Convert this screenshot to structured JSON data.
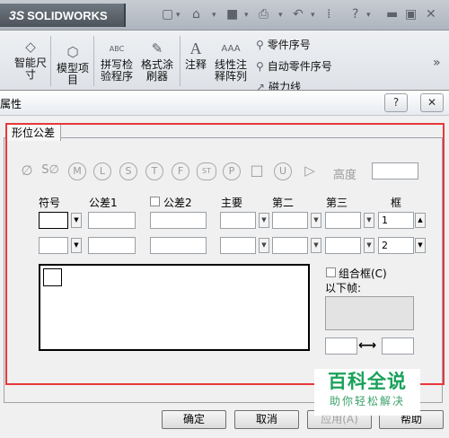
{
  "app": {
    "logo_text": "SOLIDWORKS",
    "logo_prefix": "3S"
  },
  "ribbon": {
    "smart_dimension": "智能尺\n寸",
    "model_items": "模型项\n目",
    "spell_check": "拼写检\n验程序",
    "format_painter": "格式涂\n刷器",
    "annotation": "注释",
    "linear_note_pattern": "线性注\n释阵列",
    "balloon": "零件序号",
    "auto_balloon": "自动零件序号",
    "magnetic_line": "磁力线",
    "abc_label": "ABC"
  },
  "dialog": {
    "title": "属性",
    "help_caption": "?",
    "close_caption": "✕",
    "tab": "形位公差",
    "height_label": "高度",
    "symbols": [
      "∅",
      "S∅",
      "M",
      "L",
      "S",
      "T",
      "F",
      "ST",
      "P",
      "□",
      "U",
      "▷"
    ],
    "columns": {
      "symbol": "符号",
      "tolerance1": "公差1",
      "tolerance2": "公差2",
      "primary": "主要",
      "secondary": "第二",
      "tertiary": "第三",
      "frame": "框"
    },
    "frame_row1": "1",
    "frame_row2": "2",
    "composite_frame": "组合框(C)",
    "frames_below": "以下帧:",
    "buttons": {
      "ok": "确定",
      "cancel": "取消",
      "apply": "应用(A)",
      "help": "帮助"
    }
  },
  "watermark": {
    "title": "百科全说",
    "subtitle": "助你轻松解决"
  }
}
